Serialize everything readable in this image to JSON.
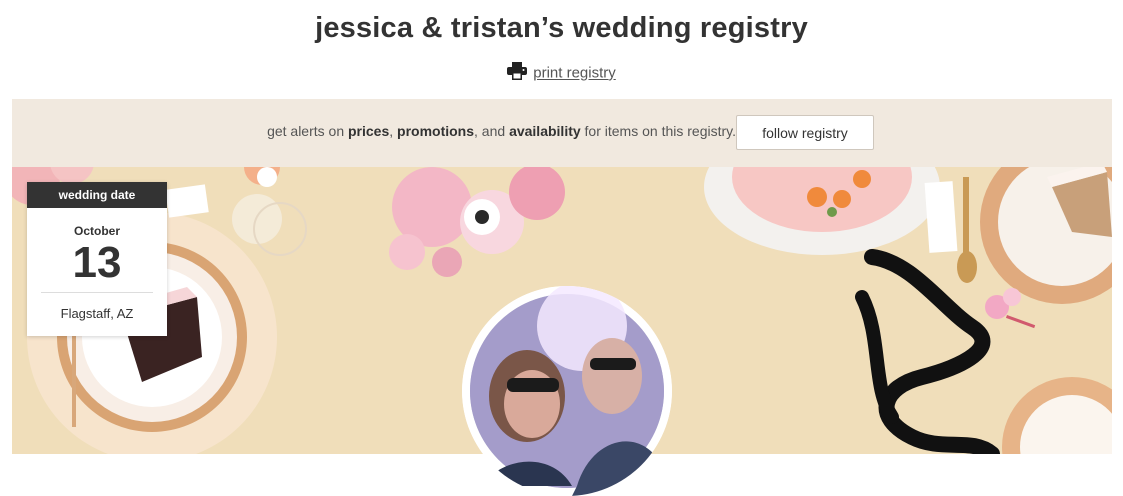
{
  "header": {
    "title": "jessica & tristan’s wedding registry",
    "print_label": "print registry",
    "print_icon": "printer-icon"
  },
  "alert_bar": {
    "text_1": "get alerts on ",
    "bold_1": "prices",
    "text_2": ", ",
    "bold_2": "promotions",
    "text_3": ", and ",
    "bold_3": "availability",
    "text_4": " for items on this registry.",
    "follow_label": "follow registry"
  },
  "date_card": {
    "heading": "wedding date",
    "month": "October",
    "day": "13",
    "location": "Flagstaff, AZ"
  },
  "colors": {
    "title_text": "#333333",
    "alert_bg": "#f1e9df",
    "banner_bg": "#efdcb6",
    "card_header": "#333333"
  }
}
